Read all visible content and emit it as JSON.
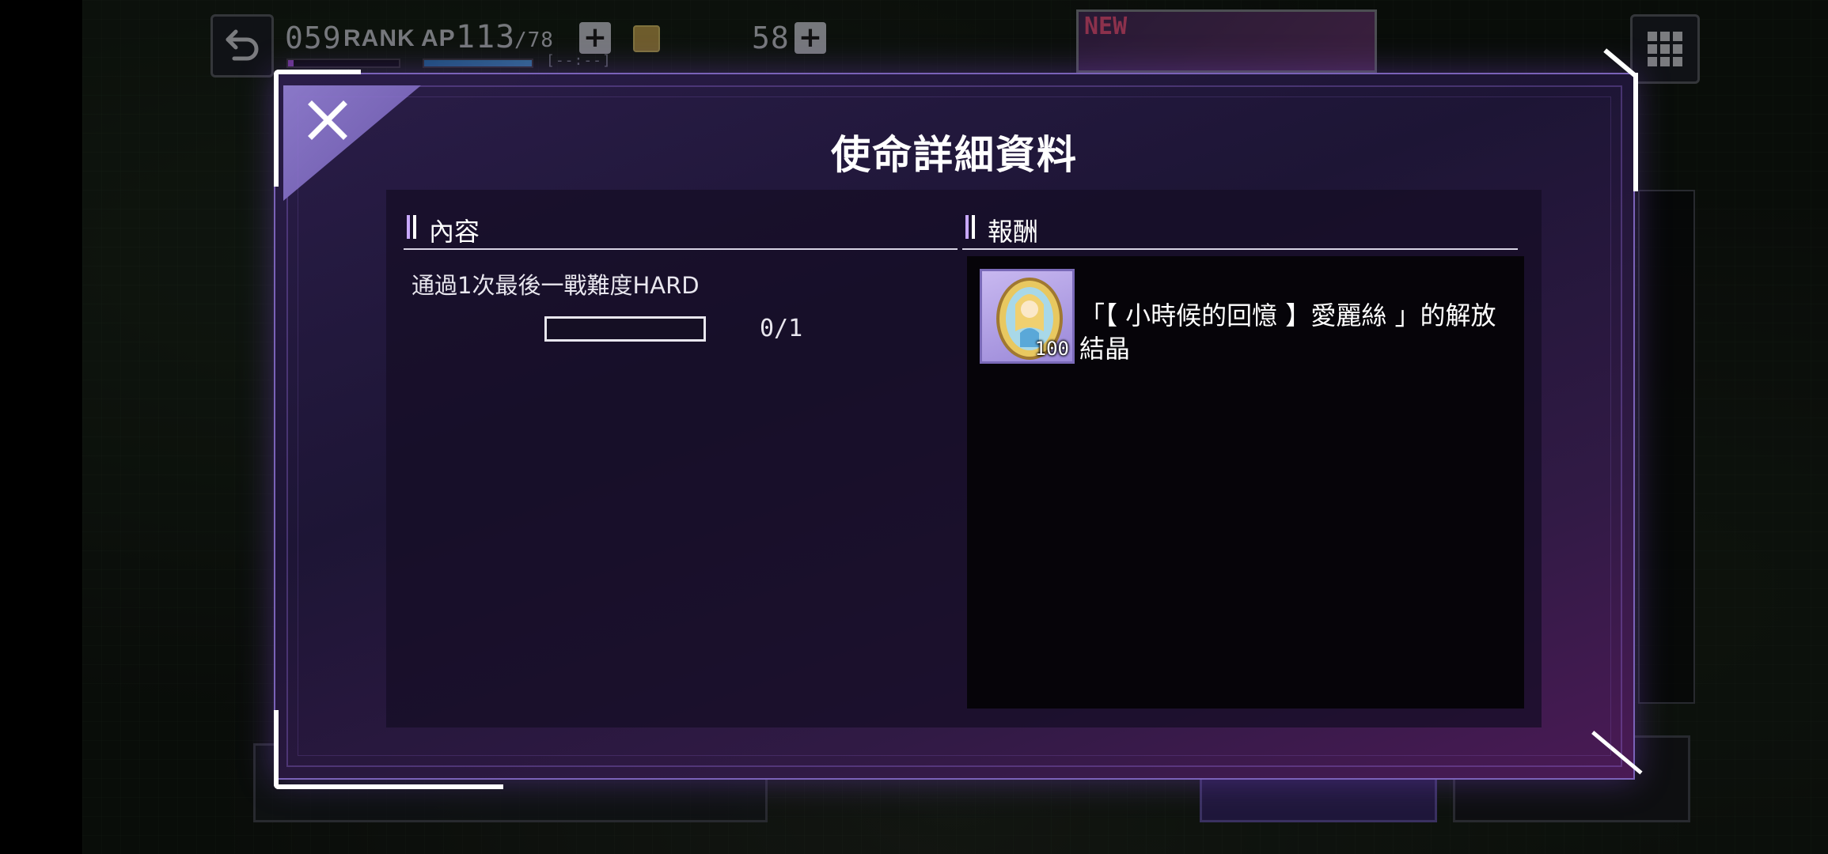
{
  "hud": {
    "rank_value": "059",
    "rank_label": "RANK",
    "rank_progress": 0.05,
    "ap_label": "AP",
    "ap_current": "113",
    "ap_max": "/78",
    "ap_progress": 1.0,
    "ap_timer": "[--:--]",
    "gem_value": "58",
    "plus_label": "+",
    "new_tag": "NEW"
  },
  "modal": {
    "title": "使命詳細資料",
    "content_header": "內容",
    "reward_header": "報酬",
    "mission_text": "通過1次最後一戰難度HARD",
    "progress_text": "0/1",
    "progress_fraction": 0,
    "reward": {
      "quantity": "100",
      "name": "「【 小時候的回憶 】愛麗絲 」的解放結晶"
    }
  },
  "colors": {
    "accent": "#7a62b8",
    "modal_bg": "#2a1d48",
    "reward_panel_bg": "#060409",
    "section_bar": "#c8a8ff"
  },
  "icons": {
    "back": "back-arrow-icon",
    "menu": "grid-menu-icon",
    "close": "close-icon",
    "gem": "gem-icon",
    "reward": "crystal-icon"
  }
}
